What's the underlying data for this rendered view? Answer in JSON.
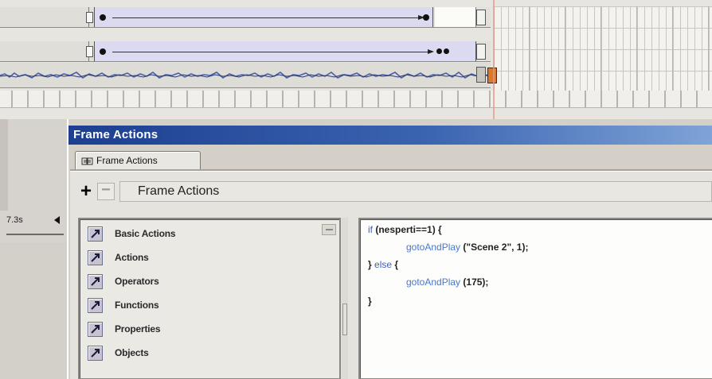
{
  "timeline": {
    "layers": [
      {
        "type": "motion-tween",
        "keyframes": 2
      },
      {
        "type": "motion-tween",
        "keyframes": 3
      },
      {
        "type": "sound-waveform"
      }
    ],
    "elapsed_time": "7.3s"
  },
  "panel": {
    "title": "Frame Actions",
    "tab_label": "Frame Actions",
    "toolbar": {
      "add_label": "+",
      "remove_label": "−",
      "breadcrumb": "Frame Actions"
    },
    "action_categories": [
      {
        "label": "Basic Actions",
        "icon": "book-icon"
      },
      {
        "label": "Actions",
        "icon": "book-icon"
      },
      {
        "label": "Operators",
        "icon": "book-icon"
      },
      {
        "label": "Functions",
        "icon": "book-icon"
      },
      {
        "label": "Properties",
        "icon": "book-icon"
      },
      {
        "label": "Objects",
        "icon": "book-icon"
      }
    ],
    "script": {
      "line1_kw": "if",
      "line1_rest": " (nesperti==1) {",
      "line2_fn": "gotoAndPlay",
      "line2_rest": " (\"Scene 2\", 1);",
      "line3_brace": "} ",
      "line3_kw": "else",
      "line3_rest": " {",
      "line4_fn": "gotoAndPlay",
      "line4_rest": " (175);",
      "line5": "}"
    }
  },
  "colors": {
    "title_bar": "#1c3f8f",
    "tween_fill": "#dcdaf1",
    "keyword": "#3d5ec4",
    "playhead": "#e09a86",
    "sound_endpoint": "#d97a2a"
  }
}
